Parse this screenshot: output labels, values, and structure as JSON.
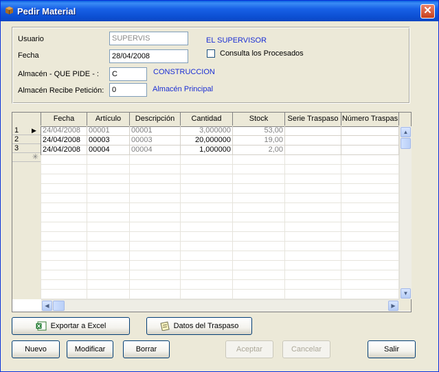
{
  "window": {
    "title": "Pedir Material",
    "close_glyph": "✕",
    "app_icon": "package-icon"
  },
  "form": {
    "usuario_label": "Usuario",
    "usuario_value": "SUPERVIS",
    "usuario_name": "EL SUPERVISOR",
    "fecha_label": "Fecha",
    "fecha_value": "28/04/2008",
    "consulta_label": "Consulta los Procesados",
    "almacen_pide_label": "Almacén - QUE PIDE - :",
    "almacen_pide_value": "C",
    "almacen_pide_name": "CONSTRUCCION",
    "almacen_recibe_label": "Almacén Recibe Petición:",
    "almacen_recibe_value": "0",
    "almacen_recibe_name": "Almacén Principal"
  },
  "grid": {
    "columns": [
      "Fecha",
      "Artículo",
      "Descripción",
      "Cantidad",
      "Stock",
      "Serie Traspaso",
      "Número Traspas"
    ],
    "rows": [
      {
        "num": "1",
        "fecha": "24/04/2008",
        "articulo": "00001",
        "descripcion": "00001",
        "cantidad": "3,000000",
        "stock": "53,00"
      },
      {
        "num": "2",
        "fecha": "24/04/2008",
        "articulo": "00003",
        "descripcion": "00003",
        "cantidad": "20,000000",
        "stock": "19,00"
      },
      {
        "num": "3",
        "fecha": "24/04/2008",
        "articulo": "00004",
        "descripcion": "00004",
        "cantidad": "1,000000",
        "stock": "2,00"
      }
    ],
    "new_row_marker": "✳",
    "current_marker": "▶"
  },
  "buttons": {
    "exportar": "Exportar a Excel",
    "datos": "Datos del Traspaso",
    "nuevo": "Nuevo",
    "modificar": "Modificar",
    "borrar": "Borrar",
    "aceptar": "Aceptar",
    "cancelar": "Cancelar",
    "salir": "Salir"
  }
}
